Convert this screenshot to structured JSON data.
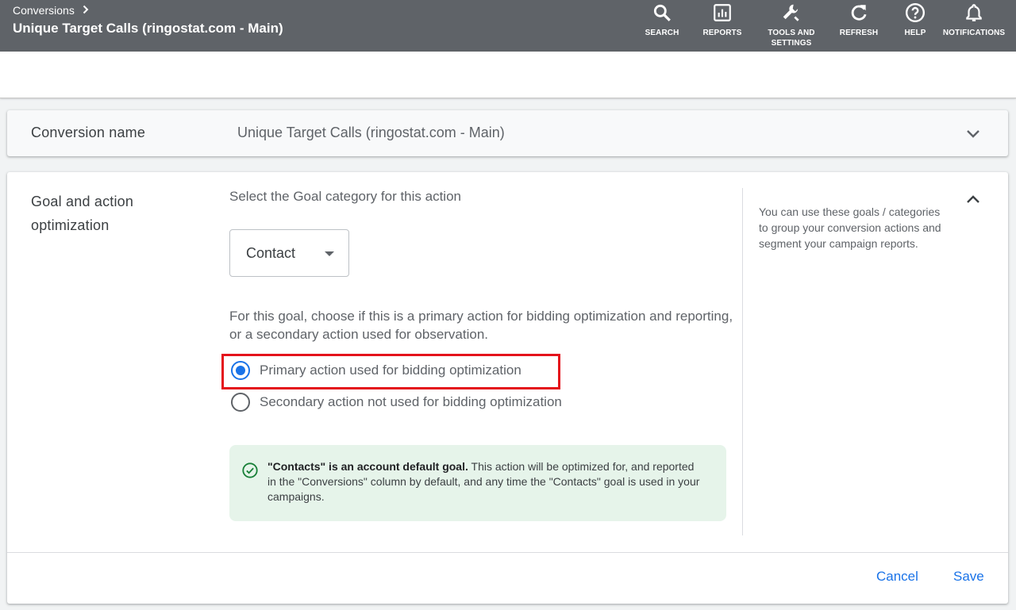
{
  "header": {
    "breadcrumb": "Conversions",
    "title": "Unique Target Calls (ringostat.com - Main)",
    "tools": [
      {
        "icon": "search-icon",
        "label": "SEARCH"
      },
      {
        "icon": "reports-icon",
        "label": "REPORTS"
      },
      {
        "icon": "wrench-icon",
        "label": "TOOLS AND SETTINGS"
      },
      {
        "icon": "refresh-icon",
        "label": "REFRESH"
      },
      {
        "icon": "help-icon",
        "label": "HELP"
      },
      {
        "icon": "bell-icon",
        "label": "NOTIFICATIONS"
      }
    ]
  },
  "conversion_name": {
    "label": "Conversion name",
    "value": "Unique Target Calls (ringostat.com - Main)"
  },
  "goal_section": {
    "label": "Goal and action optimization",
    "select_heading": "Select the Goal category for this action",
    "selected_category": "Contact",
    "description": "For this goal, choose if this is a primary action for bidding optimization and reporting, or a secondary action used for observation.",
    "options": [
      {
        "label": "Primary action used for bidding optimization",
        "selected": true
      },
      {
        "label": "Secondary action not used for bidding optimization",
        "selected": false
      }
    ],
    "note_bold": "\"Contacts\" is an account default goal.",
    "note_text": " This action will be optimized for, and reported in the \"Conversions\" column by default, and any time the \"Contacts\" goal is used in your campaigns.",
    "help_text": "You can use these goals / categories to group your conversion actions and segment your campaign reports."
  },
  "actions": {
    "cancel": "Cancel",
    "save": "Save"
  },
  "colors": {
    "header_bg": "#5f6368",
    "accent": "#1a73e8",
    "highlight": "#e4121b",
    "note_bg": "#e6f4ea",
    "success": "#188038"
  }
}
